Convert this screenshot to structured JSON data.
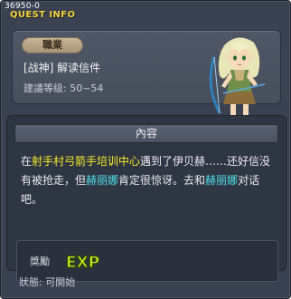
{
  "window": {
    "quest_id": "36950-0",
    "title": "QUEST INFO"
  },
  "header": {
    "job_label": "職業",
    "quest_name": "[战神] 解读信件",
    "level_range": "建議等级: 50~54"
  },
  "content": {
    "section_title": "內容",
    "paragraph": [
      {
        "text": "在",
        "style": "normal"
      },
      {
        "text": "射手村弓箭手培训中心",
        "style": "yellow"
      },
      {
        "text": "遇到了伊贝赫……还好信没有被抢走，但",
        "style": "normal"
      },
      {
        "text": "赫丽娜",
        "style": "cyan"
      },
      {
        "text": "肯定很惊讶。去和",
        "style": "normal"
      },
      {
        "text": "赫丽娜",
        "style": "cyan"
      },
      {
        "text": "对话吧。",
        "style": "normal"
      }
    ],
    "reward": {
      "label": "獎勵",
      "exp_text": "EXP"
    }
  },
  "status": {
    "text": "狀態: 可開始"
  },
  "colors": {
    "highlight_yellow": "#f6ea2a",
    "highlight_cyan": "#4fe3ee",
    "title_yellow": "#f3d23a"
  },
  "icons": {
    "npc": "npc-archer-portrait",
    "reward": "exp-icon"
  }
}
